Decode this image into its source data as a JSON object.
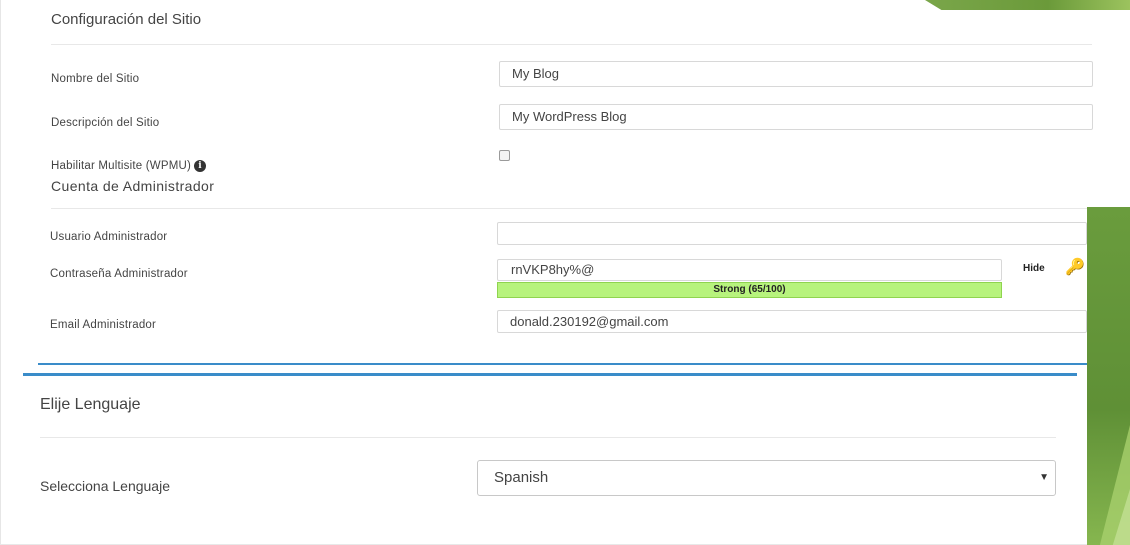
{
  "site_config": {
    "title": "Configuración del Sitio",
    "site_name": {
      "label": "Nombre del Sitio",
      "value": "My Blog"
    },
    "site_description": {
      "label": "Descripción del Sitio",
      "value": "My WordPress Blog"
    },
    "multisite": {
      "label": "Habilitar Multisite (WPMU)",
      "checked": false
    }
  },
  "admin_account": {
    "title": "Cuenta de Administrador",
    "username": {
      "label": "Usuario Administrador",
      "value": ""
    },
    "password": {
      "label": "Contraseña Administrador",
      "value": "rnVKP8hy%@",
      "strength": "Strong (65/100)",
      "hide_label": "Hide"
    },
    "email": {
      "label": "Email Administrador",
      "value": "donald.230192@gmail.com"
    }
  },
  "language": {
    "title": "Elije Lenguaje",
    "select_label": "Selecciona Lenguaje",
    "selected": "Spanish"
  },
  "colors": {
    "accent_blue": "#3a8cc9",
    "strength_green": "#b7f37d",
    "decor_green": "#6a9c3d"
  }
}
